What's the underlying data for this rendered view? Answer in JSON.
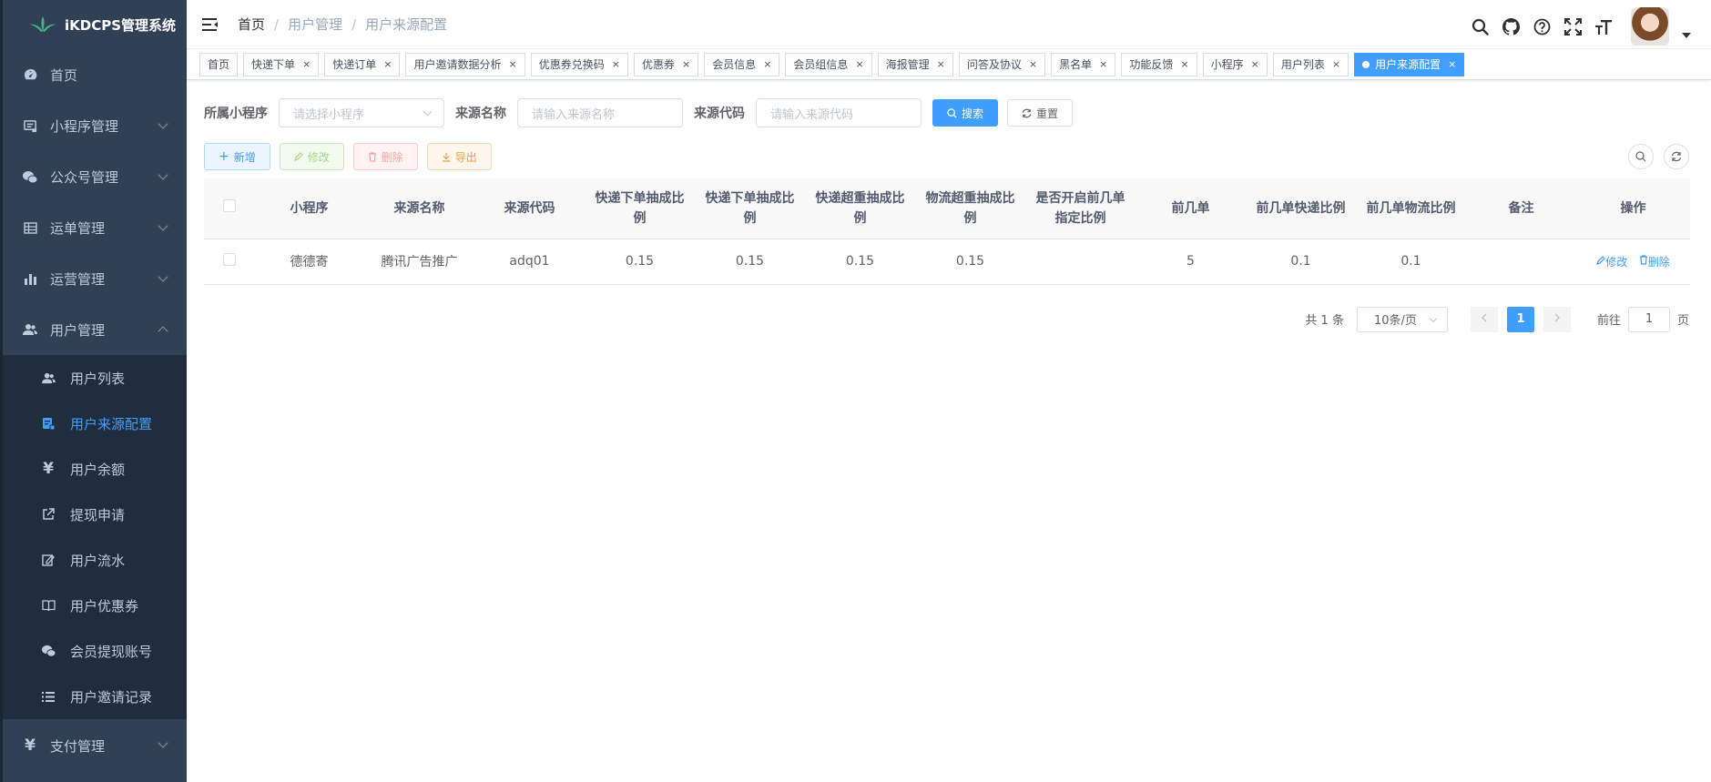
{
  "app": {
    "title": "iKDCPS管理系统"
  },
  "sidebar": {
    "items": [
      {
        "label": "首页",
        "icon": "dashboard-icon"
      },
      {
        "label": "小程序管理",
        "icon": "miniapp-icon"
      },
      {
        "label": "公众号管理",
        "icon": "wechat-icon"
      },
      {
        "label": "运单管理",
        "icon": "grid-icon"
      },
      {
        "label": "运营管理",
        "icon": "chart-icon"
      },
      {
        "label": "用户管理",
        "icon": "peoples-icon"
      }
    ],
    "sub_items": [
      {
        "label": "用户列表",
        "icon": "peoples-icon"
      },
      {
        "label": "用户来源配置",
        "icon": "form-icon"
      },
      {
        "label": "用户余额",
        "icon": "yen-icon"
      },
      {
        "label": "提现申请",
        "icon": "external-link-icon"
      },
      {
        "label": "用户流水",
        "icon": "edit-icon"
      },
      {
        "label": "用户优惠券",
        "icon": "book-icon"
      },
      {
        "label": "会员提现账号",
        "icon": "wechat-icon"
      },
      {
        "label": "用户邀请记录",
        "icon": "list-icon"
      }
    ],
    "bottom_items": [
      {
        "label": "支付管理",
        "icon": "yen-icon"
      }
    ]
  },
  "breadcrumb": [
    "首页",
    "用户管理",
    "用户来源配置"
  ],
  "tags": [
    {
      "label": "首页",
      "closable": false
    },
    {
      "label": "快递下单",
      "closable": true
    },
    {
      "label": "快递订单",
      "closable": true
    },
    {
      "label": "用户邀请数据分析",
      "closable": true
    },
    {
      "label": "优惠券兑换码",
      "closable": true
    },
    {
      "label": "优惠券",
      "closable": true
    },
    {
      "label": "会员信息",
      "closable": true
    },
    {
      "label": "会员组信息",
      "closable": true
    },
    {
      "label": "海报管理",
      "closable": true
    },
    {
      "label": "问答及协议",
      "closable": true
    },
    {
      "label": "黑名单",
      "closable": true
    },
    {
      "label": "功能反馈",
      "closable": true
    },
    {
      "label": "小程序",
      "closable": true
    },
    {
      "label": "用户列表",
      "closable": true
    },
    {
      "label": "用户来源配置",
      "closable": true,
      "active": true
    }
  ],
  "search": {
    "miniapp_label": "所属小程序",
    "miniapp_placeholder": "请选择小程序",
    "source_name_label": "来源名称",
    "source_name_placeholder": "请输入来源名称",
    "source_code_label": "来源代码",
    "source_code_placeholder": "请输入来源代码",
    "search_btn": "搜索",
    "reset_btn": "重置"
  },
  "toolbar": {
    "add": "新增",
    "edit": "修改",
    "delete": "删除",
    "export": "导出"
  },
  "table": {
    "columns": [
      "小程序",
      "来源名称",
      "来源代码",
      "快递下单抽成比例",
      "快递下单抽成比例",
      "快递超重抽成比例",
      "物流超重抽成比例",
      "是否开启前几单指定比例",
      "前几单",
      "前几单快递比例",
      "前几单物流比例",
      "备注",
      "操作"
    ],
    "rows": [
      {
        "miniapp": "德德寄",
        "source_name": "腾讯广告推广",
        "source_code": "adq01",
        "c1": "0.15",
        "c2": "0.15",
        "c3": "0.15",
        "c4": "0.15",
        "enabled": "",
        "first_n": "5",
        "first_express": "0.1",
        "first_logistics": "0.1",
        "remark": "",
        "op_edit": "修改",
        "op_delete": "删除"
      }
    ]
  },
  "pagination": {
    "total": "共 1 条",
    "page_size": "10条/页",
    "current": "1",
    "goto_label": "前往",
    "goto_value": "1",
    "page_unit": "页"
  },
  "colors": {
    "primary": "#409eff",
    "sidebar_bg": "#304156",
    "submenu_bg": "#1f2d3d"
  }
}
